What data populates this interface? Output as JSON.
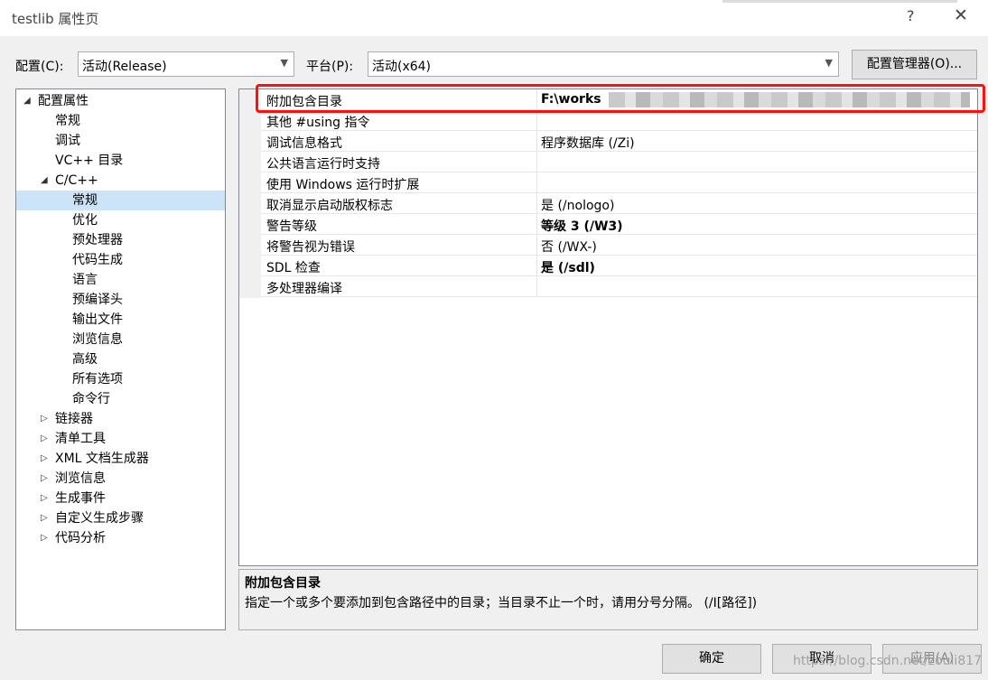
{
  "window": {
    "title": "testlib 属性页",
    "help_glyph": "?",
    "close_glyph": "✕"
  },
  "config": {
    "label": "配置(C):",
    "value": "活动(Release)"
  },
  "platform": {
    "label": "平台(P):",
    "value": "活动(x64)"
  },
  "config_manager_button": "配置管理器(O)...",
  "tree": [
    {
      "label": "配置属性",
      "expander": "◢",
      "indent": 0
    },
    {
      "label": "常规",
      "expander": "",
      "indent": 1
    },
    {
      "label": "调试",
      "expander": "",
      "indent": 1
    },
    {
      "label": "VC++ 目录",
      "expander": "",
      "indent": 1
    },
    {
      "label": "C/C++",
      "expander": "◢",
      "indent": 1
    },
    {
      "label": "常规",
      "expander": "",
      "indent": 2,
      "selected": true
    },
    {
      "label": "优化",
      "expander": "",
      "indent": 2
    },
    {
      "label": "预处理器",
      "expander": "",
      "indent": 2
    },
    {
      "label": "代码生成",
      "expander": "",
      "indent": 2
    },
    {
      "label": "语言",
      "expander": "",
      "indent": 2
    },
    {
      "label": "预编译头",
      "expander": "",
      "indent": 2
    },
    {
      "label": "输出文件",
      "expander": "",
      "indent": 2
    },
    {
      "label": "浏览信息",
      "expander": "",
      "indent": 2
    },
    {
      "label": "高级",
      "expander": "",
      "indent": 2
    },
    {
      "label": "所有选项",
      "expander": "",
      "indent": 2
    },
    {
      "label": "命令行",
      "expander": "",
      "indent": 2
    },
    {
      "label": "链接器",
      "expander": "▷",
      "indent": 1
    },
    {
      "label": "清单工具",
      "expander": "▷",
      "indent": 1
    },
    {
      "label": "XML 文档生成器",
      "expander": "▷",
      "indent": 1
    },
    {
      "label": "浏览信息",
      "expander": "▷",
      "indent": 1
    },
    {
      "label": "生成事件",
      "expander": "▷",
      "indent": 1
    },
    {
      "label": "自定义生成步骤",
      "expander": "▷",
      "indent": 1
    },
    {
      "label": "代码分析",
      "expander": "▷",
      "indent": 1
    }
  ],
  "properties": [
    {
      "name": "附加包含目录",
      "value": "F:\\works",
      "bold": true,
      "redacted": true
    },
    {
      "name": "其他 #using 指令",
      "value": "",
      "bold": false
    },
    {
      "name": "调试信息格式",
      "value": "程序数据库 (/Zi)",
      "bold": false
    },
    {
      "name": "公共语言运行时支持",
      "value": "",
      "bold": false
    },
    {
      "name": "使用 Windows 运行时扩展",
      "value": "",
      "bold": false
    },
    {
      "name": "取消显示启动版权标志",
      "value": "是 (/nologo)",
      "bold": false
    },
    {
      "name": "警告等级",
      "value": "等级 3 (/W3)",
      "bold": true
    },
    {
      "name": "将警告视为错误",
      "value": "否 (/WX-)",
      "bold": false
    },
    {
      "name": "SDL 检查",
      "value": "是 (/sdl)",
      "bold": true
    },
    {
      "name": "多处理器编译",
      "value": "",
      "bold": false
    }
  ],
  "description": {
    "title": "附加包含目录",
    "text": "指定一个或多个要添加到包含路径中的目录；当目录不止一个时，请用分号分隔。     (/I[路径])"
  },
  "buttons": {
    "ok": "确定",
    "cancel": "取消",
    "apply": "应用(A)"
  },
  "watermark": "https://blog.csdn.net/zouli817"
}
